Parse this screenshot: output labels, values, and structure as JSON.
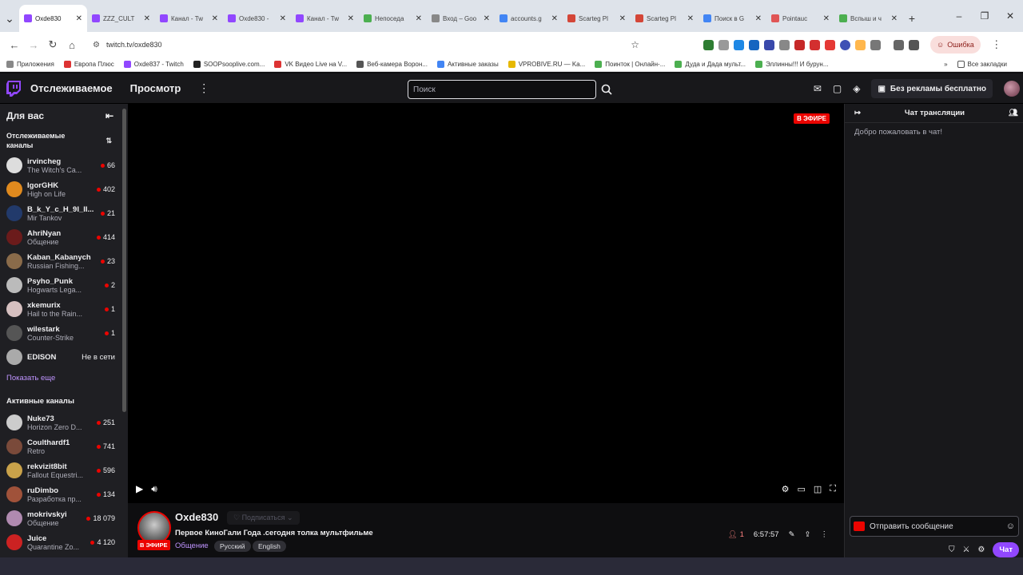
{
  "browser": {
    "tabs": [
      {
        "title": "Oxde830",
        "color": "#9147ff",
        "active": true
      },
      {
        "title": "ZZZ_CULT",
        "color": "#9147ff"
      },
      {
        "title": "Канал - Tw",
        "color": "#9147ff"
      },
      {
        "title": "Oxde830 -",
        "color": "#9147ff"
      },
      {
        "title": "Канал - Tw",
        "color": "#9147ff"
      },
      {
        "title": "Непоседа",
        "color": "#4caf50"
      },
      {
        "title": "Вход – Goo",
        "color": "#888888"
      },
      {
        "title": "accounts.g",
        "color": "#4285f4"
      },
      {
        "title": "Scarteg Pl",
        "color": "#d44638"
      },
      {
        "title": "Scarteg Pl",
        "color": "#d44638"
      },
      {
        "title": "Поиск в G",
        "color": "#4285f4"
      },
      {
        "title": "Pointauc",
        "color": "#e05555"
      },
      {
        "title": "Вспыш и ч",
        "color": "#4caf50"
      }
    ],
    "new_tab": "+",
    "url": "twitch.tv/oxde830",
    "error_label": "Ошибка",
    "bookmarks": [
      {
        "label": "Приложения",
        "color": "#888888"
      },
      {
        "label": "Европа Плюс",
        "color": "#d33"
      },
      {
        "label": "Oxde837 - Twitch",
        "color": "#9147ff"
      },
      {
        "label": "SOOPsooplive.com...",
        "color": "#222"
      },
      {
        "label": "VK Видео Live на V...",
        "color": "#d33"
      },
      {
        "label": "Веб-камера Ворон...",
        "color": "#555"
      },
      {
        "label": "Активные заказы",
        "color": "#4285f4"
      },
      {
        "label": "VPROBIVE.RU — Ka...",
        "color": "#e6b800"
      },
      {
        "label": "Поинток | Онлайн-...",
        "color": "#4caf50"
      },
      {
        "label": "Дуда и Дада мульт...",
        "color": "#4caf50"
      },
      {
        "label": "Эллинны!!! И бурун...",
        "color": "#4caf50"
      }
    ],
    "all_bookmarks": "Все закладки"
  },
  "twitch": {
    "nav_following": "Отслеживаемое",
    "nav_browse": "Просмотр",
    "search_placeholder": "Поиск",
    "turbo_label": "Без рекламы бесплатно"
  },
  "sidebar": {
    "title": "Для вас",
    "followed_title": "Отслеживаемые каналы",
    "followed": [
      {
        "name": "irvincheg",
        "game": "The Witch's Ca...",
        "viewers": "66",
        "color": "#ddd"
      },
      {
        "name": "IgorGHK",
        "game": "High on Life",
        "viewers": "402",
        "color": "#e08a1e"
      },
      {
        "name": "B_k_Y_c_H_9I_II...",
        "game": "Mir Tankov",
        "viewers": "21",
        "color": "#223a6b"
      },
      {
        "name": "AhriNyan",
        "game": "Общение",
        "viewers": "414",
        "color": "#6b1b1b"
      },
      {
        "name": "Kaban_Kabanych",
        "game": "Russian Fishing...",
        "viewers": "23",
        "color": "#8a6b4a"
      },
      {
        "name": "Psyho_Punk",
        "game": "Hogwarts Lega...",
        "viewers": "2",
        "color": "#bbb"
      },
      {
        "name": "xkemurix",
        "game": "Hail to the Rain...",
        "viewers": "1",
        "color": "#d6c0c0"
      },
      {
        "name": "wilestark",
        "game": "Counter-Strike",
        "viewers": "1",
        "color": "#555"
      }
    ],
    "offline": {
      "name": "EDISON",
      "status": "Не в сети",
      "color": "#aaa"
    },
    "show_more": "Показать еще",
    "active_title": "Активные каналы",
    "active": [
      {
        "name": "Nuke73",
        "game": "Horizon Zero D...",
        "viewers": "251",
        "color": "#ccc"
      },
      {
        "name": "Coulthardf1",
        "game": "Retro",
        "viewers": "741",
        "color": "#7a4a3a"
      },
      {
        "name": "rekvizit8bit",
        "game": "Fallout Equestri...",
        "viewers": "596",
        "color": "#c9a24a"
      },
      {
        "name": "ruDimbo",
        "game": "Разработка пр...",
        "viewers": "134",
        "color": "#a0523a"
      },
      {
        "name": "mokrivskyi",
        "game": "Общение",
        "viewers": "18 079",
        "color": "#b08ab0"
      },
      {
        "name": "Juice",
        "game": "Quarantine Zo...",
        "viewers": "4 120",
        "color": "#c22"
      }
    ]
  },
  "player": {
    "live_badge": "В ЭФИРЕ"
  },
  "stream": {
    "channel": "Oxde830",
    "follow_label": "Подписаться",
    "title": "Первое КиноГали Года .сегодня толка мультфильме",
    "category": "Общение",
    "tags": [
      "Русский",
      "English"
    ],
    "live_badge": "В ЭФИРЕ",
    "viewers": "1",
    "uptime": "6:57:57"
  },
  "chat": {
    "title": "Чат трансляции",
    "welcome": "Добро пожаловать в чат!",
    "input_placeholder": "Отправить сообщение",
    "send_label": "Чат"
  },
  "colors": {
    "accent": "#9147ff",
    "live": "#eb0400"
  }
}
